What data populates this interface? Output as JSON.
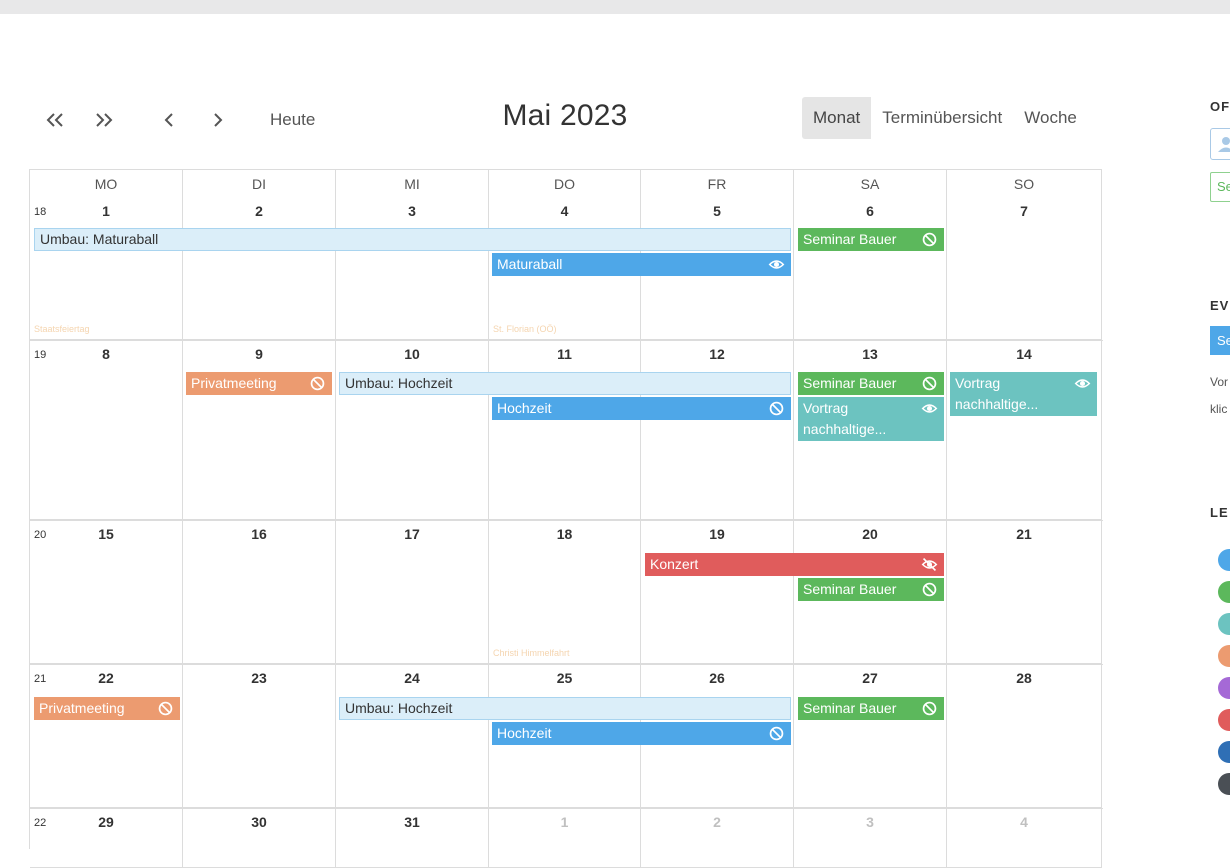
{
  "toolbar": {
    "today_label": "Heute",
    "title": "Mai 2023",
    "views": [
      {
        "label": "Monat",
        "active": true
      },
      {
        "label": "Terminübersicht",
        "active": false
      },
      {
        "label": "Woche",
        "active": false
      }
    ]
  },
  "calendar": {
    "weekdays": [
      "MO",
      "DI",
      "MI",
      "DO",
      "FR",
      "SA",
      "SO"
    ],
    "weeks": [
      {
        "weeknum": "18",
        "days": [
          "1",
          "2",
          "3",
          "4",
          "5",
          "6",
          "7"
        ]
      },
      {
        "weeknum": "19",
        "days": [
          "8",
          "9",
          "10",
          "11",
          "12",
          "13",
          "14"
        ]
      },
      {
        "weeknum": "20",
        "days": [
          "15",
          "16",
          "17",
          "18",
          "19",
          "20",
          "21"
        ]
      },
      {
        "weeknum": "21",
        "days": [
          "22",
          "23",
          "24",
          "25",
          "26",
          "27",
          "28"
        ]
      },
      {
        "weeknum": "22",
        "days": [
          "29",
          "30",
          "31",
          "1",
          "2",
          "3",
          "4"
        ]
      }
    ],
    "holidays": {
      "staatsfeiertag": "Staatsfeiertag",
      "florian": "St. Florian (OÖ)",
      "himmelfahrt": "Christi Himmelfahrt"
    },
    "events": {
      "umbau_maturaball": "Umbau: Maturaball",
      "maturaball": "Maturaball",
      "seminar_bauer": "Seminar Bauer",
      "privatmeeting": "Privatmeeting",
      "umbau_hochzeit": "Umbau: Hochzeit",
      "hochzeit": "Hochzeit",
      "vortrag": "Vortrag nachhaltige...",
      "konzert": "Konzert"
    }
  },
  "colors": {
    "green": "#5cb85c",
    "blue": "#4ea7e8",
    "teal": "#6cc3c0",
    "orange": "#ec9b70",
    "red": "#e05c5c",
    "purple": "#a569d6",
    "darkblue": "#2f6fb5",
    "dark": "#4a4f55"
  },
  "sidebar": {
    "heading_1": "OF",
    "box_label": "Se",
    "heading_2": "EV",
    "button_label": "Se",
    "text_1": "Vor",
    "text_2": "klic",
    "heading_3": "LE"
  }
}
